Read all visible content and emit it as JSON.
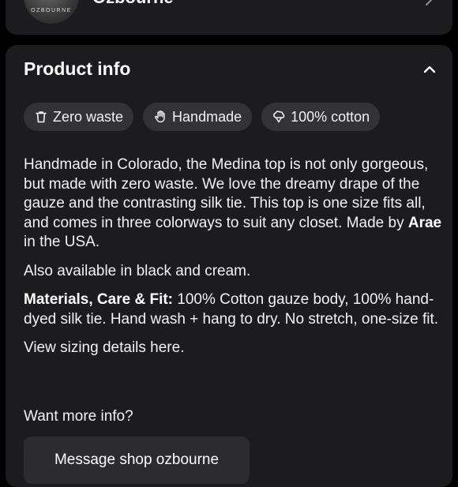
{
  "shop": {
    "avatar_text": "OZBOURNE",
    "name": "Ozbourne"
  },
  "product_info": {
    "title": "Product info",
    "badges": [
      {
        "icon": "trash-icon",
        "label": "Zero waste"
      },
      {
        "icon": "hand-icon",
        "label": "Handmade"
      },
      {
        "icon": "cotton-icon",
        "label": "100% cotton"
      }
    ],
    "description": {
      "p1_text": "Handmade in Colorado, the Medina top is not only gorgeous, but made with zero waste. We love the dreamy drape of the gauze and the contrasting silk tie. This top is one size fits all, and comes in three colorways to suit any closet. Made by ",
      "p1_maker": "Arae",
      "p1_suffix": " in the USA.",
      "p2": "Also available in black and cream.",
      "p3_label": "Materials, Care & Fit:",
      "p3_text": " 100% Cotton gauze body, 100% hand-dyed silk tie. Hand wash + hang to dry. No stretch, one-size fit.",
      "p4": "View sizing details here."
    },
    "more_info_label": "Want more info?",
    "message_button": "Message shop ozbourne"
  },
  "colors": {
    "background": "#000000",
    "card": "#1c1c1e",
    "chip": "#333336",
    "text": "#f2f2f2"
  }
}
